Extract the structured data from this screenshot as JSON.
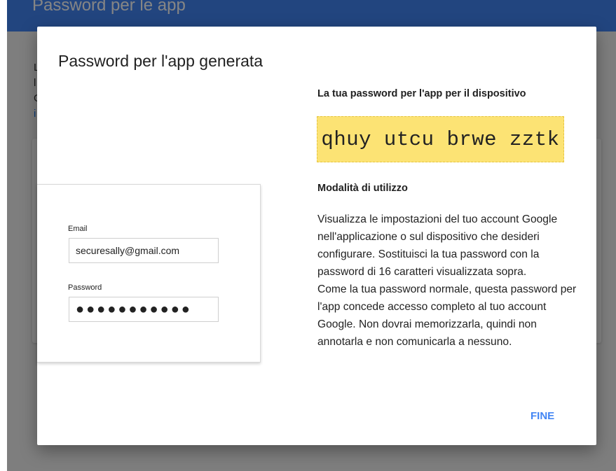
{
  "background": {
    "header_title": "Password per le app",
    "header_dash": "-",
    "snippets": [
      "L",
      "l",
      "G",
      "i"
    ]
  },
  "dialog": {
    "title": "Password per l'app generata",
    "password_heading": "La tua password per l'app per il dispositivo",
    "app_password": "qhuy utcu brwe zztk",
    "usage_heading": "Modalità di utilizzo",
    "usage_paragraph_1": "Visualizza le impostazioni del tuo account Google nell'applicazione o sul dispositivo che desideri configurare. Sostituisci la tua password con la password di 16 caratteri visualizzata sopra.",
    "usage_paragraph_2": "Come la tua password normale, questa password per l'app concede accesso completo al tuo account Google. Non dovrai memorizzarla, quindi non annotarla e non comunicarla a nessuno.",
    "done_label": "FINE"
  },
  "illustration": {
    "email_label": "Email",
    "email_value": "securesally@gmail.com",
    "password_label": "Password",
    "password_mask": "●●●●●●●●●●●"
  },
  "colors": {
    "accent": "#4285f4",
    "password_highlight": "#fce374"
  }
}
